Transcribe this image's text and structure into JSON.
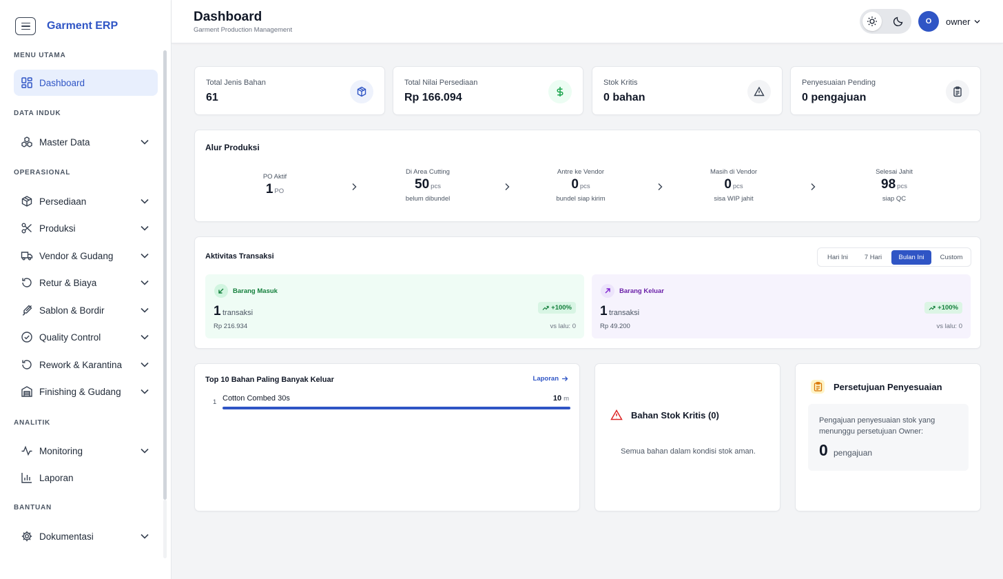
{
  "app": {
    "brand": "Garment ERP",
    "page_title": "Dashboard",
    "page_subtitle": "Garment Production Management",
    "user": {
      "initial": "O",
      "name": "owner"
    }
  },
  "sidebar": {
    "sections": [
      {
        "title": "MENU UTAMA",
        "items": [
          {
            "label": "Dashboard",
            "icon": "grid-icon",
            "active": true
          }
        ]
      },
      {
        "title": "DATA INDUK",
        "items": [
          {
            "label": "Master Data",
            "icon": "boxes-icon"
          }
        ]
      },
      {
        "title": "OPERASIONAL",
        "items": [
          {
            "label": "Persediaan",
            "icon": "package-icon"
          },
          {
            "label": "Produksi",
            "icon": "scissors-icon"
          },
          {
            "label": "Vendor & Gudang",
            "icon": "truck-icon"
          },
          {
            "label": "Retur & Biaya",
            "icon": "rotate-icon"
          },
          {
            "label": "Sablon & Bordir",
            "icon": "brush-icon"
          },
          {
            "label": "Quality Control",
            "icon": "check-circle-icon"
          },
          {
            "label": "Rework & Karantina",
            "icon": "rotate-icon"
          },
          {
            "label": "Finishing & Gudang",
            "icon": "warehouse-icon"
          }
        ]
      },
      {
        "title": "ANALITIK",
        "items": [
          {
            "label": "Monitoring",
            "icon": "activity-icon"
          },
          {
            "label": "Laporan",
            "icon": "bar-chart-icon"
          }
        ]
      },
      {
        "title": "BANTUAN",
        "items": [
          {
            "label": "Dokumentasi",
            "icon": "gear-icon"
          }
        ]
      }
    ]
  },
  "stats": [
    {
      "label": "Total Jenis Bahan",
      "value": "61",
      "icon": "box-icon",
      "color": "#2f55c5"
    },
    {
      "label": "Total Nilai Persediaan",
      "value": "Rp 166.094",
      "icon": "dollar-icon",
      "color": "#16a34a"
    },
    {
      "label": "Stok Kritis",
      "value": "0 bahan",
      "icon": "warning-icon",
      "color": "#374151"
    },
    {
      "label": "Penyesuaian Pending",
      "value": "0 pengajuan",
      "icon": "clipboard-icon",
      "color": "#374151"
    }
  ],
  "flow": {
    "title": "Alur Produksi",
    "steps": [
      {
        "label": "PO Aktif",
        "value": "1",
        "unit": "PO",
        "note": ""
      },
      {
        "label": "Di Area Cutting",
        "value": "50",
        "unit": "pcs",
        "note": "belum dibundel"
      },
      {
        "label": "Antre ke Vendor",
        "value": "0",
        "unit": "pcs",
        "note": "bundel siap kirim"
      },
      {
        "label": "Masih di Vendor",
        "value": "0",
        "unit": "pcs",
        "note": "sisa WIP jahit"
      },
      {
        "label": "Selesai Jahit",
        "value": "98",
        "unit": "pcs",
        "note": "siap QC"
      }
    ]
  },
  "activity": {
    "title": "Aktivitas Transaksi",
    "ranges": [
      "Hari Ini",
      "7 Hari",
      "Bulan Ini",
      "Custom"
    ],
    "active_range": "Bulan Ini",
    "incoming": {
      "title": "Barang Masuk",
      "count": "1",
      "unit": "transaksi",
      "amount": "Rp 216.934",
      "change": "+100%",
      "prev": "vs lalu: 0"
    },
    "outgoing": {
      "title": "Barang Keluar",
      "count": "1",
      "unit": "transaksi",
      "amount": "Rp 49.200",
      "change": "+100%",
      "prev": "vs lalu: 0"
    }
  },
  "top_materials": {
    "title": "Top 10 Bahan Paling Banyak Keluar",
    "link": "Laporan",
    "items": [
      {
        "rank": "1",
        "name": "Cotton Combed 30s",
        "qty": "10",
        "unit": "m",
        "share": 1.0
      }
    ]
  },
  "critical": {
    "title": "Bahan Stok Kritis (0)",
    "message": "Semua bahan dalam kondisi stok aman."
  },
  "approvals": {
    "title": "Persetujuan Penyesuaian",
    "text": "Pengajuan penyesuaian stok yang menunggu persetujuan Owner:",
    "count": "0",
    "unit": "pengajuan"
  }
}
